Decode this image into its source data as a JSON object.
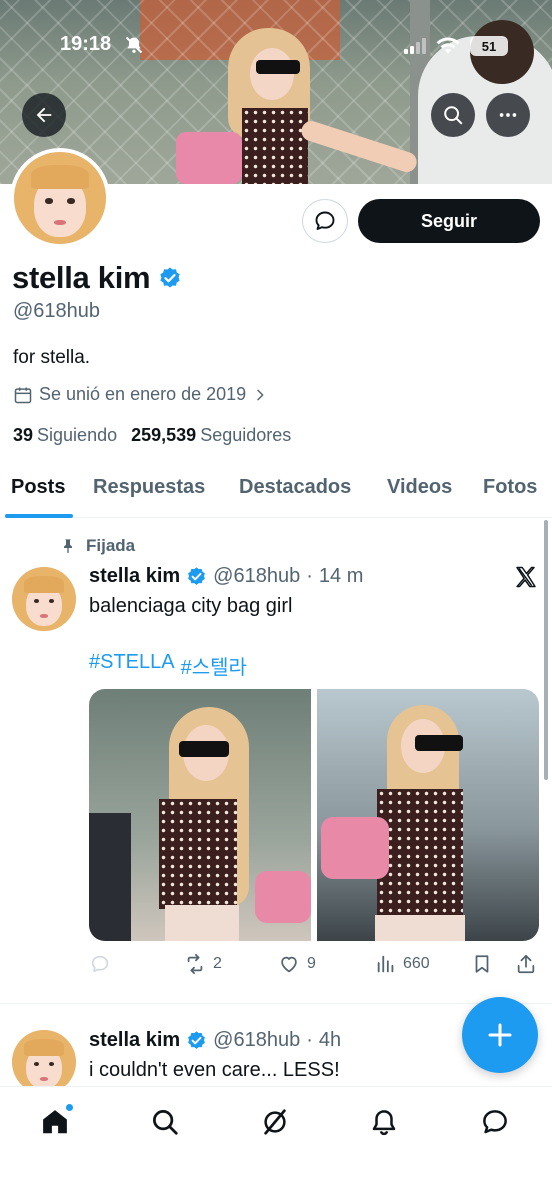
{
  "status_bar": {
    "time": "19:18",
    "battery": "51"
  },
  "profile": {
    "name": "stella kim",
    "handle": "@618hub",
    "bio": "for stella.",
    "joined": "Se unió en enero de 2019",
    "following_count": "39",
    "following_label": "Siguiendo",
    "followers_count": "259,539",
    "followers_label": "Seguidores",
    "follow_button": "Seguir"
  },
  "tabs": [
    "Posts",
    "Respuestas",
    "Destacados",
    "Videos",
    "Fotos"
  ],
  "active_tab": "Posts",
  "posts": [
    {
      "pinned_label": "Fijada",
      "name": "stella kim",
      "handle": "@618hub",
      "separator": "·",
      "time": "14 m",
      "text": "balenciaga city bag girl",
      "hashtags": [
        "#STELLA",
        "#스텔라"
      ],
      "retweets": "2",
      "likes": "9",
      "views": "660"
    },
    {
      "name": "stella kim",
      "handle": "@618hub",
      "separator": "·",
      "time": "4h",
      "text": "i couldn't even care... LESS!"
    }
  ],
  "colors": {
    "accent": "#1d9bf0",
    "text": "#0f1419",
    "secondary": "#536471"
  },
  "icons": {
    "top_left": "back-arrow-icon",
    "top_right": [
      "search-icon",
      "more-icon"
    ],
    "bottom_nav": [
      "home-icon",
      "search-icon",
      "grok-icon",
      "notifications-icon",
      "messages-icon"
    ]
  }
}
